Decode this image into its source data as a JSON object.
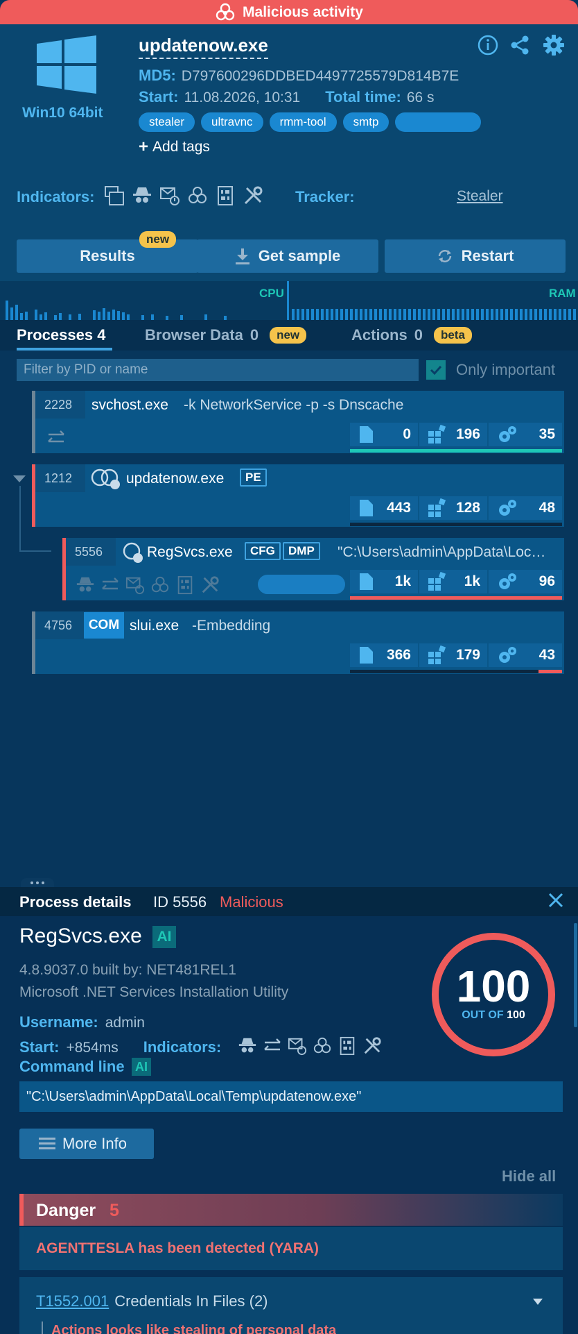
{
  "banner": {
    "label": "Malicious activity",
    "icon": "biohazard-icon"
  },
  "header": {
    "os": "Win10 64bit",
    "filename": "updatenow.exe",
    "md5_label": "MD5:",
    "md5": "D797600296DDBED4497725579D814B7E",
    "start_label": "Start:",
    "start": "11.08.2026, 10:31",
    "total_label": "Total time:",
    "total": "66 s",
    "tags": [
      "stealer",
      "ultravnc",
      "rmm-tool",
      "smtp",
      ""
    ],
    "add_tags": "Add tags",
    "indicators_label": "Indicators:",
    "tracker_label": "Tracker:",
    "tracker_value": "Stealer",
    "buttons": {
      "results": "Results",
      "results_badge": "new",
      "get_sample": "Get sample",
      "restart": "Restart"
    }
  },
  "graph": {
    "cpu": "CPU",
    "ram": "RAM"
  },
  "tabs": {
    "processes": "Processes 4",
    "browser": "Browser Data",
    "browser_count": "0",
    "browser_badge": "new",
    "actions": "Actions",
    "actions_count": "0",
    "actions_badge": "beta"
  },
  "filter": {
    "placeholder": "Filter by PID or name",
    "only_important": "Only important"
  },
  "processes": [
    {
      "pid": "2228",
      "name": "svchost.exe",
      "args": "-k NetworkService -p -s Dnscache",
      "files": "0",
      "registry": "196",
      "modules": "35"
    },
    {
      "pid": "1212",
      "name": "updatenow.exe",
      "pill": "PE",
      "files": "443",
      "registry": "128",
      "modules": "48"
    },
    {
      "pid": "5556",
      "name": "RegSvcs.exe",
      "pill1": "CFG",
      "pill2": "DMP",
      "args": "\"C:\\Users\\admin\\AppData\\Loc…",
      "files": "1k",
      "registry": "1k",
      "modules": "96"
    },
    {
      "pid": "4756",
      "com": "COM",
      "name": "slui.exe",
      "args": "-Embedding",
      "files": "366",
      "registry": "179",
      "modules": "43"
    }
  ],
  "details": {
    "title": "Process details",
    "id": "ID 5556",
    "verdict": "Malicious",
    "name": "RegSvcs.exe",
    "ai": "AI",
    "version": "4.8.9037.0 built by: NET481REL1",
    "description": "Microsoft .NET Services Installation Utility",
    "username_label": "Username:",
    "username": "admin",
    "start_label": "Start:",
    "start": "+854ms",
    "indicators_label": "Indicators:",
    "cmd_label": "Command line",
    "cmd": "\"C:\\Users\\admin\\AppData\\Local\\Temp\\updatenow.exe\"",
    "more_info": "More Info",
    "hide_all": "Hide all",
    "score": "100",
    "score_out": "OUT OF",
    "score_max": "100",
    "danger_label": "Danger",
    "danger_count": "5",
    "danger_item": "AGENTTESLA has been detected (YARA)",
    "mitre_id": "T1552.001",
    "mitre_name": "Credentials In Files (2)",
    "mitre_sub": "Actions looks like stealing of personal data"
  },
  "colors": {
    "malicious": "#ef5b5b",
    "accent": "#4fb6ef",
    "tag": "#1a88d1",
    "badge": "#f5c34b"
  }
}
